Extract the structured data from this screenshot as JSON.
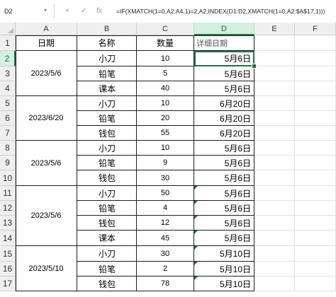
{
  "formula_bar": {
    "name_box": "D2",
    "cancel_symbol": "×",
    "enter_symbol": "✓",
    "fx_label": "fx",
    "formula": "=IF(XMATCH(1=0,A2:A4,1)=2,A2,INDEX(D1:D2,XMATCH(1=0,A2:$A$17,1)))"
  },
  "columns": [
    "A",
    "B",
    "C",
    "D",
    "E",
    "F"
  ],
  "rows": [
    "1",
    "2",
    "3",
    "4",
    "5",
    "6",
    "7",
    "8",
    "9",
    "10",
    "11",
    "12",
    "13",
    "14",
    "15",
    "16",
    "17"
  ],
  "header_row": {
    "a": "日期",
    "b": "名称",
    "c": "数量",
    "d": "详细日期"
  },
  "date_groups": [
    {
      "date": "2023/5/6"
    },
    {
      "date": "2023/6/20"
    },
    {
      "date": "2023/5/6"
    },
    {
      "date": "2023/5/6"
    },
    {
      "date": "2023/5/10"
    }
  ],
  "data_rows": [
    {
      "b": "小刀",
      "c": "10",
      "d": "5月6日"
    },
    {
      "b": "铅笔",
      "c": "5",
      "d": "5月6日"
    },
    {
      "b": "课本",
      "c": "40",
      "d": "5月6日"
    },
    {
      "b": "小刀",
      "c": "10",
      "d": "6月20日"
    },
    {
      "b": "铅笔",
      "c": "20",
      "d": "6月20日"
    },
    {
      "b": "钱包",
      "c": "55",
      "d": "6月20日"
    },
    {
      "b": "小刀",
      "c": "10",
      "d": "5月6日"
    },
    {
      "b": "铅笔",
      "c": "9",
      "d": "5月6日"
    },
    {
      "b": "钱包",
      "c": "30",
      "d": "5月6日"
    },
    {
      "b": "小刀",
      "c": "50",
      "d": "5月6日"
    },
    {
      "b": "铅笔",
      "c": "4",
      "d": "5月6日"
    },
    {
      "b": "钱包",
      "c": "12",
      "d": "5月6日"
    },
    {
      "b": "课本",
      "c": "45",
      "d": "5月6日"
    },
    {
      "b": "小刀",
      "c": "30",
      "d": "5月10日"
    },
    {
      "b": "铅笔",
      "c": "2",
      "d": "5月10日"
    },
    {
      "b": "钱包",
      "c": "78",
      "d": "5月10日"
    }
  ],
  "colors": {
    "accent": "#217346",
    "header_bg": "#efefef",
    "selected_header_bg": "#d3f0e0",
    "error_flag": "#1a7a3a"
  }
}
